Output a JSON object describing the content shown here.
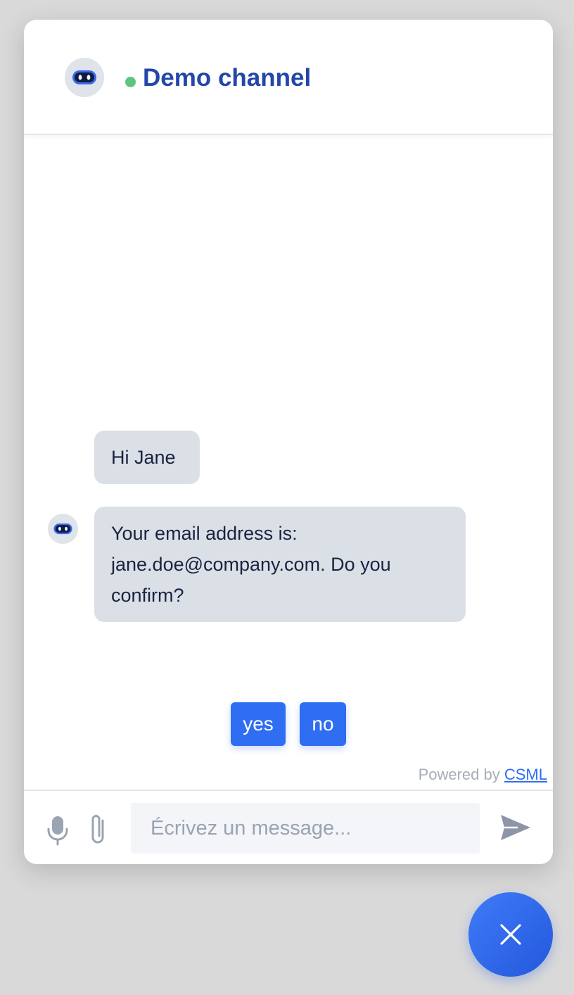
{
  "header": {
    "title": "Demo channel",
    "status_color": "#62c27f",
    "avatar_icon": "robot-icon"
  },
  "messages": [
    {
      "sender": "bot",
      "text": "Hi Jane"
    },
    {
      "sender": "bot",
      "text": "Your email address is: jane.doe@company.com. Do you confirm?"
    }
  ],
  "quick_replies": [
    "yes",
    "no"
  ],
  "powered_by": {
    "prefix": "Powered by",
    "link": "CSML"
  },
  "composer": {
    "placeholder": "Écrivez un message...",
    "value": "",
    "icons": [
      "microphone-icon",
      "paperclip-icon",
      "send-icon"
    ]
  },
  "close_button_icon": "close-icon",
  "colors": {
    "accent": "#2f6df2",
    "title": "#2247a8",
    "bubble_bg": "#dbe0e7"
  }
}
